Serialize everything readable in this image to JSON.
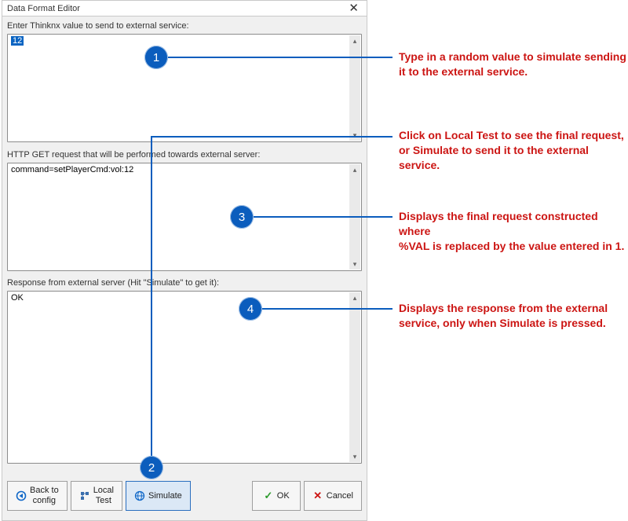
{
  "dialog": {
    "title": "Data Format Editor",
    "labels": {
      "input": "Enter Thinknx value to send to external service:",
      "request": "HTTP GET request that will be performed towards external server:",
      "response": "Response from external server (Hit \"Simulate\" to get it):"
    },
    "fields": {
      "input_value": "12",
      "request_value": "command=setPlayerCmd:vol:12",
      "response_value": "OK"
    },
    "buttons": {
      "back1": "Back to",
      "back2": "config",
      "local1": "Local",
      "local2": "Test",
      "simulate": "Simulate",
      "ok": "OK",
      "cancel": "Cancel"
    }
  },
  "annotations": {
    "n1": "1",
    "n2": "2",
    "n3": "3",
    "n4": "4",
    "t1a": "Type in a random value to simulate sending",
    "t1b": "it to the external service.",
    "t2a": "Click on Local Test to see the final request,",
    "t2b": "or Simulate to send it to the external service.",
    "t3a": "Displays the final request constructed where",
    "t3b": "%VAL is replaced by the value entered in 1.",
    "t4a": "Displays the response from the external",
    "t4b": "service, only when Simulate is pressed."
  }
}
